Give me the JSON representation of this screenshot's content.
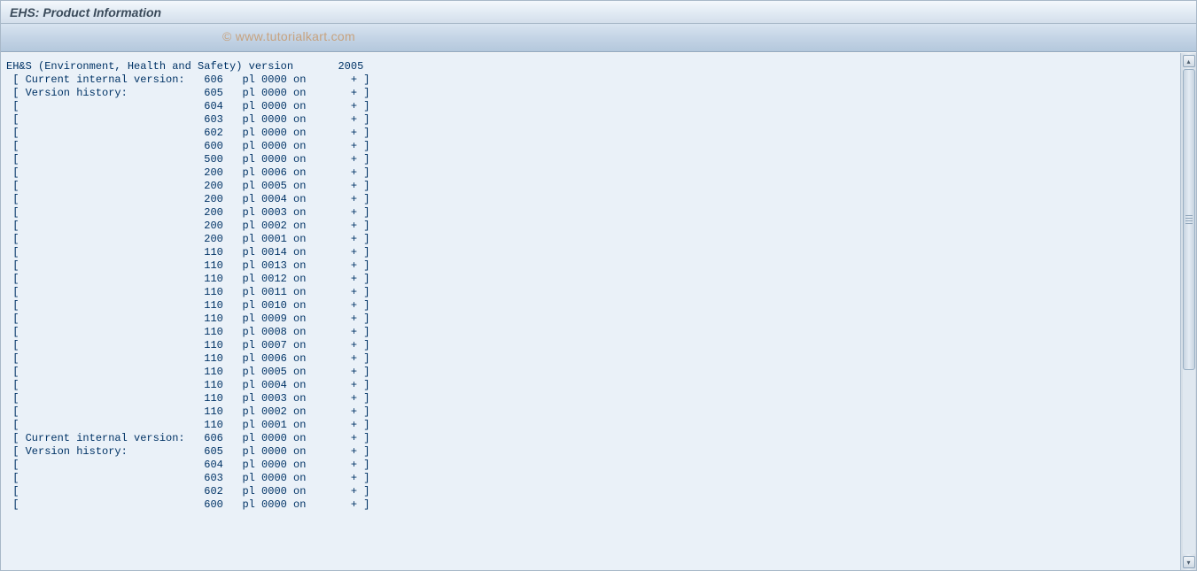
{
  "title": "EHS: Product Information",
  "watermark": "© www.tutorialkart.com",
  "header_line": "EH&S (Environment, Health and Safety) version       2005",
  "rows": [
    {
      "label": "Current internal version:",
      "ver": "606",
      "pl": "0000"
    },
    {
      "label": "Version history:",
      "ver": "605",
      "pl": "0000"
    },
    {
      "label": "",
      "ver": "604",
      "pl": "0000"
    },
    {
      "label": "",
      "ver": "603",
      "pl": "0000"
    },
    {
      "label": "",
      "ver": "602",
      "pl": "0000"
    },
    {
      "label": "",
      "ver": "600",
      "pl": "0000"
    },
    {
      "label": "",
      "ver": "500",
      "pl": "0000"
    },
    {
      "label": "",
      "ver": "200",
      "pl": "0006"
    },
    {
      "label": "",
      "ver": "200",
      "pl": "0005"
    },
    {
      "label": "",
      "ver": "200",
      "pl": "0004"
    },
    {
      "label": "",
      "ver": "200",
      "pl": "0003"
    },
    {
      "label": "",
      "ver": "200",
      "pl": "0002"
    },
    {
      "label": "",
      "ver": "200",
      "pl": "0001"
    },
    {
      "label": "",
      "ver": "110",
      "pl": "0014"
    },
    {
      "label": "",
      "ver": "110",
      "pl": "0013"
    },
    {
      "label": "",
      "ver": "110",
      "pl": "0012"
    },
    {
      "label": "",
      "ver": "110",
      "pl": "0011"
    },
    {
      "label": "",
      "ver": "110",
      "pl": "0010"
    },
    {
      "label": "",
      "ver": "110",
      "pl": "0009"
    },
    {
      "label": "",
      "ver": "110",
      "pl": "0008"
    },
    {
      "label": "",
      "ver": "110",
      "pl": "0007"
    },
    {
      "label": "",
      "ver": "110",
      "pl": "0006"
    },
    {
      "label": "",
      "ver": "110",
      "pl": "0005"
    },
    {
      "label": "",
      "ver": "110",
      "pl": "0004"
    },
    {
      "label": "",
      "ver": "110",
      "pl": "0003"
    },
    {
      "label": "",
      "ver": "110",
      "pl": "0002"
    },
    {
      "label": "",
      "ver": "110",
      "pl": "0001"
    },
    {
      "label": "Current internal version:",
      "ver": "606",
      "pl": "0000"
    },
    {
      "label": "Version history:",
      "ver": "605",
      "pl": "0000"
    },
    {
      "label": "",
      "ver": "604",
      "pl": "0000"
    },
    {
      "label": "",
      "ver": "603",
      "pl": "0000"
    },
    {
      "label": "",
      "ver": "602",
      "pl": "0000"
    },
    {
      "label": "",
      "ver": "600",
      "pl": "0000"
    }
  ]
}
